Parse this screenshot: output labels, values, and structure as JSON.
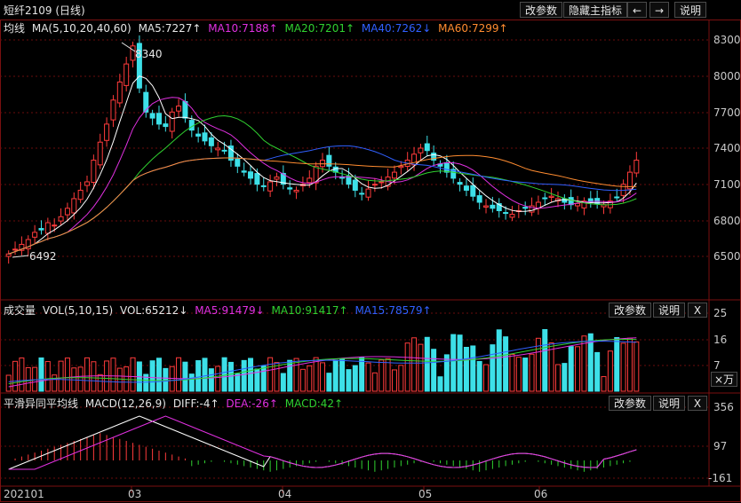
{
  "header": {
    "title": "短纤2109 (日线)",
    "buttons": {
      "params": "改参数",
      "hide_main": "隐藏主指标",
      "help": "说明"
    },
    "nav": {
      "left": "←",
      "right": "→"
    }
  },
  "main_panel": {
    "legend": {
      "name": "均线",
      "params": "MA(5,10,20,40,60)",
      "ma5": "MA5:7227↑",
      "ma10": "MA10:7188↑",
      "ma20": "MA20:7201↑",
      "ma40": "MA40:7262↓",
      "ma60": "MA60:7299↑"
    },
    "y_ticks": [
      "8300",
      "8000",
      "7700",
      "7400",
      "7100",
      "6800",
      "6500"
    ],
    "high_label": "8340",
    "low_label": "6492"
  },
  "volume_panel": {
    "legend": {
      "name": "成交量",
      "params": "VOL(5,10,15)",
      "vol": "VOL:65212↓",
      "ma5": "MA5:91479↓",
      "ma10": "MA10:91417↑",
      "ma15": "MA15:78579↑"
    },
    "buttons": {
      "params": "改参数",
      "help": "说明",
      "close": "X"
    },
    "y_ticks": [
      "25",
      "16",
      "7"
    ],
    "unit": "×万"
  },
  "macd_panel": {
    "legend": {
      "name": "平滑异同平均线",
      "params": "MACD(12,26,9)",
      "diff": "DIFF:-4↑",
      "dea": "DEA:-26↑",
      "macd": "MACD:42↑"
    },
    "buttons": {
      "params": "改参数",
      "help": "说明",
      "close": "X"
    },
    "y_ticks": [
      "356",
      "97",
      "-161"
    ]
  },
  "x_axis": {
    "labels": [
      "202101",
      "03",
      "04",
      "05",
      "06"
    ]
  },
  "colors": {
    "ma5": "#ffffff",
    "ma10": "#e030e0",
    "ma20": "#30d030",
    "ma40": "#3060ff",
    "ma60": "#ff8c30",
    "up": "#ff3b3b",
    "down": "#3de0e8",
    "grid": "#7a1010"
  }
}
